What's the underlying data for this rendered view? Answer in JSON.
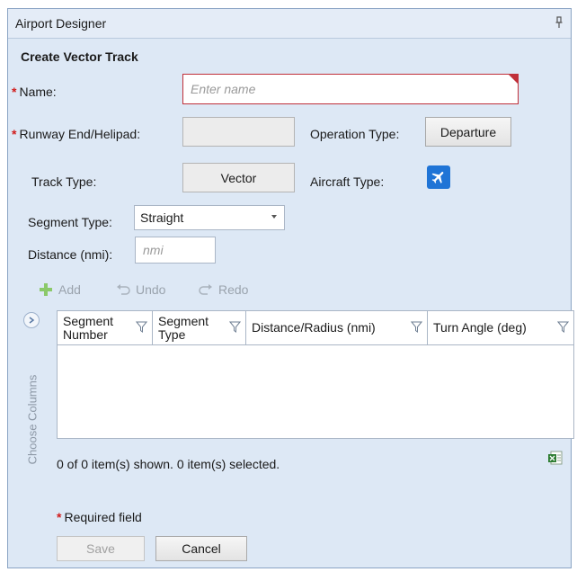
{
  "window": {
    "title": "Airport Designer",
    "pin_icon": "pin-icon"
  },
  "form": {
    "title": "Create Vector Track",
    "required_mark": "*",
    "name": {
      "label": "Name:",
      "placeholder": "Enter name",
      "value": ""
    },
    "runway": {
      "label": "Runway End/Helipad:",
      "value": ""
    },
    "operation_type": {
      "label": "Operation Type:",
      "value": "Departure"
    },
    "track_type": {
      "label": "Track Type:",
      "value": "Vector"
    },
    "aircraft_type": {
      "label": "Aircraft Type:",
      "icon": "airplane-icon"
    },
    "segment_type": {
      "label": "Segment Type:",
      "value": "Straight"
    },
    "distance": {
      "label": "Distance (nmi):",
      "placeholder": "nmi"
    }
  },
  "toolbar": {
    "add": "Add",
    "undo": "Undo",
    "redo": "Redo"
  },
  "grid": {
    "side_label": "Choose Columns",
    "columns": [
      {
        "label": "Segment Number"
      },
      {
        "label": "Segment Type"
      },
      {
        "label": "Distance/Radius (nmi)"
      },
      {
        "label": "Turn Angle (deg)"
      }
    ],
    "rows": [],
    "status": "0 of 0 item(s) shown. 0 item(s) selected."
  },
  "footer": {
    "required_text": "Required field",
    "save_label": "Save",
    "cancel_label": "Cancel"
  },
  "colors": {
    "accent": "#1f74d6",
    "required": "#d11b1b",
    "panel_bg": "#dde8f5"
  }
}
